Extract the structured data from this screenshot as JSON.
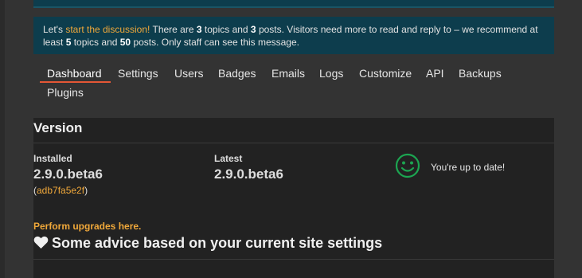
{
  "notice": {
    "prefix": "Let's ",
    "link": "start the discussion!",
    "text1": " There are ",
    "topics_count": "3",
    "text2": " topics and ",
    "posts_count": "3",
    "text3": " posts. Visitors need more to read and reply to – we recommend at least ",
    "min_topics": "5",
    "text4": " topics and ",
    "min_posts": "50",
    "text5": " posts. Only staff can see this message."
  },
  "nav": {
    "tabs": [
      {
        "label": "Dashboard",
        "active": true
      },
      {
        "label": "Settings"
      },
      {
        "label": "Users"
      },
      {
        "label": "Badges"
      },
      {
        "label": "Emails"
      },
      {
        "label": "Logs"
      },
      {
        "label": "Customize"
      },
      {
        "label": "API"
      },
      {
        "label": "Backups"
      },
      {
        "label": "Plugins"
      }
    ]
  },
  "version": {
    "title": "Version",
    "installed_label": "Installed",
    "installed_value": "2.9.0.beta6",
    "commit_open": "(",
    "commit_hash": "adb7fa5e2f",
    "commit_close": ")",
    "latest_label": "Latest",
    "latest_value": "2.9.0.beta6",
    "status_icon": "smiley-icon",
    "status_text": "You're up to date!",
    "upgrade_link": "Perform upgrades here."
  },
  "advice": {
    "icon": "heart-icon",
    "title": "Some advice based on your current site settings"
  },
  "colors": {
    "accent": "#f0a83a",
    "tab_underline": "#e45735",
    "notice_bg": "#0d3d4d",
    "success": "#1ca551"
  }
}
